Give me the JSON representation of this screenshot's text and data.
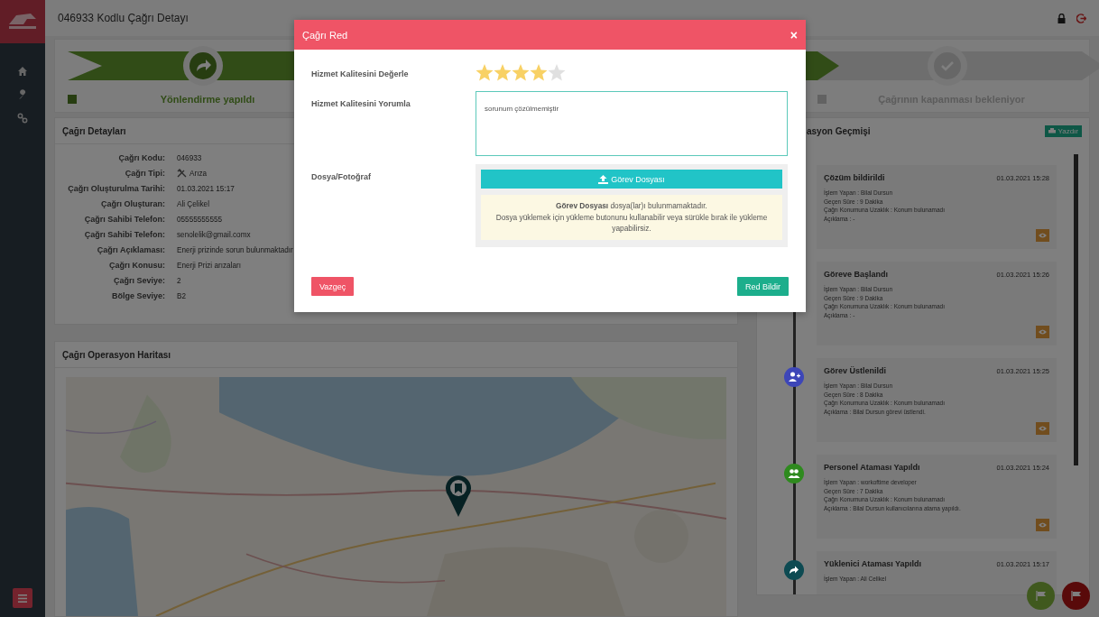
{
  "header": {
    "title": "046933 Kodlu Çağrı Detayı"
  },
  "steps": [
    {
      "label": "Yönlendirme yapıldı",
      "done": true,
      "kind": "redirect"
    },
    {
      "done": true
    },
    {
      "label": "Çağrının kapanması bekleniyor",
      "done": false,
      "kind": "check"
    }
  ],
  "details": {
    "title": "Çağrı Detayları",
    "rows": [
      {
        "label": "Çağrı Kodu:",
        "value": "046933",
        "kind": "text"
      },
      {
        "label": "Çağrı Tipi:",
        "value": "Arıza",
        "kind": "tools"
      },
      {
        "label": "Çağrı Oluşturulma Tarihi:",
        "value": "01.03.2021 15:17",
        "kind": "text"
      },
      {
        "label": "Çağrı Oluşturan:",
        "value": "Ali Çelikel",
        "kind": "text"
      },
      {
        "label": "Çağrı Sahibi Telefon:",
        "value": "05555555555",
        "kind": "text"
      },
      {
        "label": "Çağrı Sahibi Telefon:",
        "value": "senolelik@gmail.comx",
        "kind": "text"
      },
      {
        "label": "Çağrı Açıklaması:",
        "value": "Enerji prizinde sorun bulunmaktadır",
        "kind": "text"
      },
      {
        "label": "Çağrı Konusu:",
        "value": "Enerji Prizi arızaları",
        "kind": "text"
      },
      {
        "label": "Çağrı Seviye:",
        "value": "2",
        "kind": "text"
      },
      {
        "label": "Bölge Seviye:",
        "value": "B2",
        "kind": "text"
      }
    ]
  },
  "map": {
    "title": "Çağrı Operasyon Haritası",
    "kind": "picture"
  },
  "history": {
    "title": "asyon Geçmişi",
    "print_button": "Yazdır",
    "items": [
      {
        "title": "Çözüm bildirildi",
        "time": "01.03.2021 15:28",
        "lines": [
          "İşlem Yapan : Bilal Dursun",
          "Geçen Süre : 9 Dakika",
          "Çağrı Konumuna Uzaklık : Konum bulunamadı",
          "Açıklama : -"
        ],
        "view_button": true
      },
      {
        "title": "Göreve Başlandı",
        "time": "01.03.2021 15:26",
        "lines": [
          "İşlem Yapan : Bilal Dursun",
          "Geçen Süre : 9 Dakika",
          "Çağrı Konumuna Uzaklık : Konum bulunamadı",
          "Açıklama : -"
        ],
        "view_button": true
      },
      {
        "title": "Görev Üstlenildi",
        "time": "01.03.2021 15:25",
        "lines": [
          "İşlem Yapan : Bilal Dursun",
          "Geçen Süre : 8 Dakika",
          "Çağrı Konumuna Uzaklık : Konum bulunamadı",
          "Açıklama : Bilal Dursun görevi üstlendi."
        ],
        "view_button": true,
        "kind": "user-add",
        "color": "#3d46b8"
      },
      {
        "title": "Personel Ataması Yapıldı",
        "time": "01.03.2021 15:24",
        "lines": [
          "İşlem Yapan : workoftime developer",
          "Geçen Süre : 7 Dakika",
          "Çağrı Konumuna Uzaklık : Konum bulunamadı",
          "Açıklama : Bilal Dursun kullanıcılarına atama yapıldı."
        ],
        "view_button": true,
        "kind": "users",
        "color": "#2e8a1e"
      },
      {
        "title": "Yüklenici Ataması Yapıldı",
        "time": "01.03.2021 15:17",
        "lines": [
          "İşlem Yapan : Ali Celikel"
        ],
        "view_button": false,
        "kind": "redirect",
        "color": "#0d4a52"
      }
    ]
  },
  "modal": {
    "title": "Çağrı Red",
    "close": "×",
    "rating": {
      "label": "Hizmet Kalitesini Değerle",
      "stars": 4
    },
    "comment": {
      "label": "Hizmet Kalitesini Yorumla",
      "value": "sorunum çözülmemiştir"
    },
    "file": {
      "label": "Dosya/Fotoğraf",
      "button": "Görev Dosyası",
      "notice": "**Görev Dosyası** dosya(lar)ı bulunmamaktadır.",
      "hint": "Dosya yüklemek için yükleme butonunu kullanabilir veya sürükle bırak ile yükleme yapabilirsiz."
    },
    "cancel": "Vazgeç",
    "submit": "Red Bildir"
  }
}
